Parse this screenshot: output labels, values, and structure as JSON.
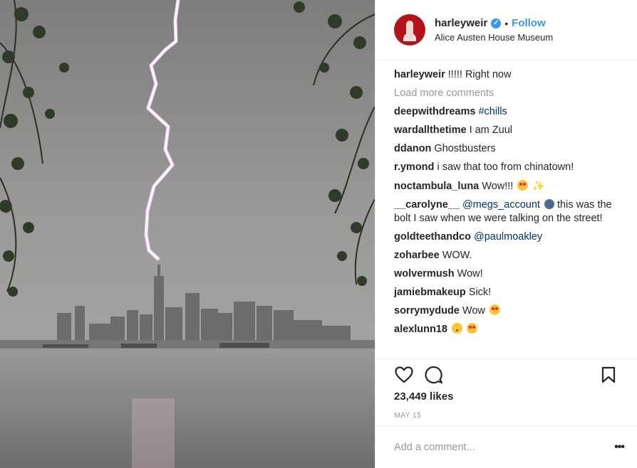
{
  "post": {
    "username": "harleyweir",
    "separator": "•",
    "follow_label": "Follow",
    "location": "Alice Austen House Museum",
    "likes": "23,449 likes",
    "date": "MAY 15",
    "add_comment_placeholder": "Add a comment...",
    "more_icon": "•••"
  },
  "caption": {
    "user": "harleyweir",
    "text": "!!!!! Right now"
  },
  "load_more_label": "Load more comments",
  "comments": [
    {
      "user": "deepwithdreams",
      "link": "#chills",
      "text": ""
    },
    {
      "user": "wardallthetime",
      "text": "I am Zuul"
    },
    {
      "user": "ddanon",
      "text": "Ghostbusters"
    },
    {
      "user": "r.ymond",
      "text": "i saw that too from chinatown!"
    },
    {
      "user": "noctambula_luna",
      "text": "Wow!!!"
    },
    {
      "user": "__carolyne__",
      "link": "@megs_account",
      "text": "this was the bolt I saw when we were talking on the street!"
    },
    {
      "user": "goldteethandco",
      "link": "@paulmoakley",
      "text": ""
    },
    {
      "user": "zoharbee",
      "text": "WOW."
    },
    {
      "user": "wolvermush",
      "text": "Wow!"
    },
    {
      "user": "jamiebmakeup",
      "text": "Sick!"
    },
    {
      "user": "sorrymydude",
      "text": "Wow"
    },
    {
      "user": "alexlunn18",
      "text": ""
    }
  ],
  "colors": {
    "link": "#3897f0",
    "text": "#262626",
    "muted": "#999999"
  }
}
